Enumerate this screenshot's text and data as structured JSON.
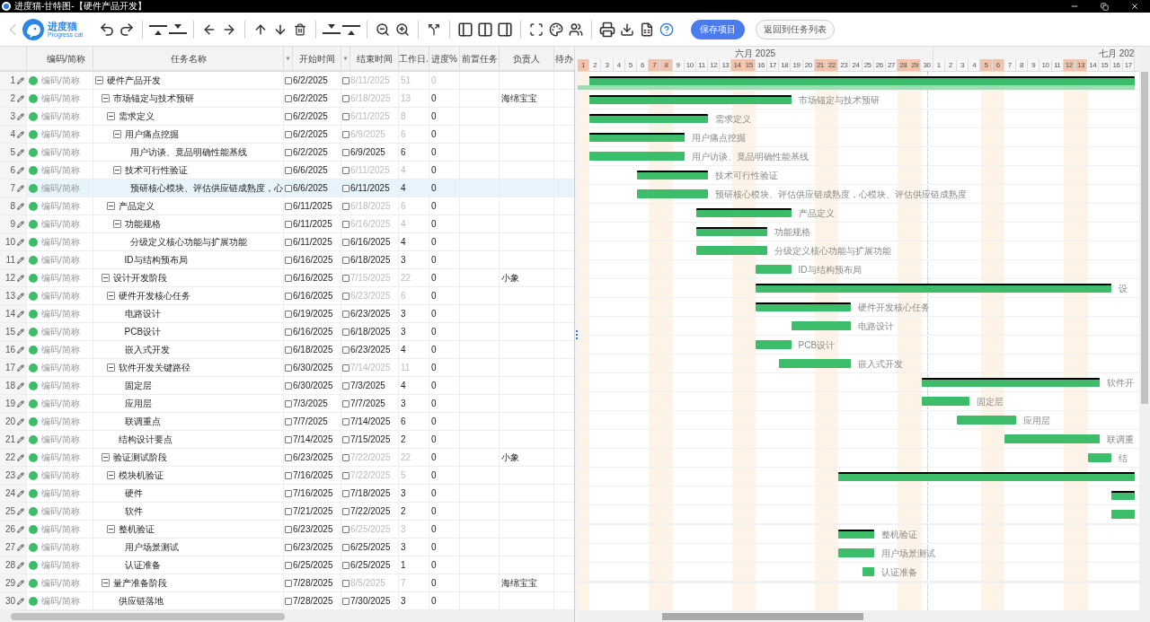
{
  "window": {
    "title": "进度猫-甘特图-【硬件产品开发】"
  },
  "logo": {
    "name": "进度猫",
    "tagline": "Progress cat"
  },
  "toolbar": {
    "save_button": "保存项目",
    "back_button": "返回到任务列表"
  },
  "table": {
    "columns": [
      "编码/简称",
      "任务名称",
      "✳",
      "开始时间",
      "✳",
      "结束时间",
      "工作日.",
      "进度%",
      "前置任务",
      "负责人",
      "待办"
    ],
    "rows": [
      {
        "n": "1",
        "code": "编码/简称",
        "name": "硬件产品开发",
        "start": "6/2/2025",
        "end": "8/11/2025",
        "days": "51",
        "progress": "0",
        "kind": "project",
        "expanded": true,
        "selected": false,
        "start_checked": false,
        "end_checked": false,
        "children": [
          {
            "n": "2",
            "code": "编码/简称",
            "name": "市场锚定与技术预研",
            "start": "6/2/2025",
            "end": "6/18/2025",
            "days": "13",
            "progress": "0",
            "owner": "海绵宝宝",
            "kind": "summary",
            "expanded": true,
            "selected": false,
            "start_checked": false,
            "end_checked": false,
            "bar_label": "市场锚定与技术预研",
            "children": [
              {
                "n": "3",
                "code": "编码/简称",
                "name": "需求定义",
                "start": "6/2/2025",
                "end": "6/11/2025",
                "days": "8",
                "progress": "0",
                "kind": "summary",
                "expanded": true,
                "selected": false,
                "start_checked": false,
                "end_checked": false,
                "bar_label": "需求定义",
                "children": [
                  {
                    "n": "4",
                    "code": "编码/简称",
                    "name": "用户痛点挖掘",
                    "start": "6/2/2025",
                    "end": "6/9/2025",
                    "days": "6",
                    "progress": "0",
                    "kind": "summary",
                    "expanded": true,
                    "selected": false,
                    "start_checked": false,
                    "end_checked": false,
                    "bar_label": "用户痛点挖掘",
                    "children": [
                      {
                        "n": "5",
                        "code": "编码/简称",
                        "name": "用户访谈、竟品明确性能基线",
                        "start": "6/2/2025",
                        "end": "6/9/2025",
                        "days": "6",
                        "progress": "0",
                        "kind": "task",
                        "selected": false,
                        "start_checked": false,
                        "end_checked": false,
                        "bar_label": "用户访谈、竟品明确性能基线"
                      }
                    ]
                  },
                  {
                    "n": "6",
                    "code": "编码/简称",
                    "name": "技术可行性验证",
                    "start": "6/6/2025",
                    "end": "6/11/2025",
                    "days": "4",
                    "progress": "0",
                    "kind": "summary",
                    "expanded": true,
                    "selected": false,
                    "start_checked": false,
                    "end_checked": false,
                    "bar_label": "技术可行性验证",
                    "children": [
                      {
                        "n": "7",
                        "code": "编码/简称",
                        "name": "预研核心模块、评估供应链成熟度，心",
                        "start": "6/6/2025",
                        "end": "6/11/2025",
                        "days": "4",
                        "progress": "0",
                        "kind": "task",
                        "selected": true,
                        "start_checked": false,
                        "end_checked": false,
                        "bar_label": "预研核心模块、评估供应链成熟度，心模块、评估供应链成熟度"
                      }
                    ]
                  }
                ]
              },
              {
                "n": "8",
                "code": "编码/简称",
                "name": "产品定义",
                "start": "6/11/2025",
                "end": "6/18/2025",
                "days": "6",
                "progress": "0",
                "kind": "summary",
                "expanded": true,
                "selected": false,
                "start_checked": false,
                "end_checked": false,
                "bar_label": "产品定义",
                "children": [
                  {
                    "n": "9",
                    "code": "编码/简称",
                    "name": "功能规格",
                    "start": "6/11/2025",
                    "end": "6/16/2025",
                    "days": "4",
                    "progress": "0",
                    "kind": "summary",
                    "expanded": true,
                    "selected": false,
                    "start_checked": false,
                    "end_checked": false,
                    "bar_label": "功能规格",
                    "children": [
                      {
                        "n": "10",
                        "code": "编码/简称",
                        "name": "分级定义核心功能与扩展功能",
                        "start": "6/11/2025",
                        "end": "6/16/2025",
                        "days": "4",
                        "progress": "0",
                        "kind": "task",
                        "selected": false,
                        "start_checked": false,
                        "end_checked": false,
                        "bar_label": "分级定义核心功能与扩展功能"
                      }
                    ]
                  },
                  {
                    "n": "11",
                    "code": "编码/简称",
                    "name": "ID与结构预布局",
                    "start": "6/16/2025",
                    "end": "6/18/2025",
                    "days": "3",
                    "progress": "0",
                    "kind": "task",
                    "selected": false,
                    "start_checked": false,
                    "end_checked": false,
                    "bar_label": "ID与结构预布局"
                  }
                ]
              }
            ]
          },
          {
            "n": "12",
            "code": "编码/简称",
            "name": "设计开发阶段",
            "start": "6/16/2025",
            "end": "7/15/2025",
            "days": "22",
            "progress": "0",
            "owner": "小象",
            "kind": "summary",
            "expanded": true,
            "selected": false,
            "start_checked": false,
            "end_checked": false,
            "bar_label": "设",
            "children": [
              {
                "n": "13",
                "code": "编码/简称",
                "name": "硬件开发核心任务",
                "start": "6/16/2025",
                "end": "6/23/2025",
                "days": "6",
                "progress": "0",
                "kind": "summary",
                "expanded": true,
                "selected": false,
                "start_checked": false,
                "end_checked": false,
                "bar_label": "硬件开发核心任务",
                "children": [
                  {
                    "n": "14",
                    "code": "编码/简称",
                    "name": "电路设计",
                    "start": "6/19/2025",
                    "end": "6/23/2025",
                    "days": "3",
                    "progress": "0",
                    "kind": "task",
                    "selected": false,
                    "start_checked": false,
                    "end_checked": false,
                    "bar_label": "电路设计"
                  },
                  {
                    "n": "15",
                    "code": "编码/简称",
                    "name": "PCB设计",
                    "start": "6/16/2025",
                    "end": "6/18/2025",
                    "days": "3",
                    "progress": "0",
                    "kind": "task",
                    "selected": false,
                    "start_checked": false,
                    "end_checked": false,
                    "bar_label": "PCB设计"
                  },
                  {
                    "n": "16",
                    "code": "编码/简称",
                    "name": "嵌入式开发",
                    "start": "6/18/2025",
                    "end": "6/23/2025",
                    "days": "4",
                    "progress": "0",
                    "kind": "task",
                    "selected": false,
                    "start_checked": false,
                    "end_checked": false,
                    "bar_label": "嵌入式开发"
                  }
                ]
              },
              {
                "n": "17",
                "code": "编码/简称",
                "name": "软件开发关键路径",
                "start": "6/30/2025",
                "end": "7/14/2025",
                "days": "11",
                "progress": "0",
                "kind": "summary",
                "expanded": true,
                "selected": false,
                "start_checked": false,
                "end_checked": false,
                "bar_label": "软件开",
                "children": [
                  {
                    "n": "18",
                    "code": "编码/简称",
                    "name": "固定层",
                    "start": "6/30/2025",
                    "end": "7/3/2025",
                    "days": "4",
                    "progress": "0",
                    "kind": "task",
                    "selected": false,
                    "start_checked": false,
                    "end_checked": false,
                    "bar_label": "固定层"
                  },
                  {
                    "n": "19",
                    "code": "编码/简称",
                    "name": "应用层",
                    "start": "7/3/2025",
                    "end": "7/7/2025",
                    "days": "3",
                    "progress": "0",
                    "kind": "task",
                    "selected": false,
                    "start_checked": false,
                    "end_checked": false,
                    "bar_label": "应用层"
                  },
                  {
                    "n": "20",
                    "code": "编码/简称",
                    "name": "联调重点",
                    "start": "7/7/2025",
                    "end": "7/14/2025",
                    "days": "6",
                    "progress": "0",
                    "kind": "task",
                    "selected": false,
                    "start_checked": false,
                    "end_checked": false,
                    "bar_label": "联调重"
                  }
                ]
              },
              {
                "n": "21",
                "code": "编码/简称",
                "name": "结构设计要点",
                "start": "7/14/2025",
                "end": "7/15/2025",
                "days": "2",
                "progress": "0",
                "kind": "task",
                "selected": false,
                "start_checked": false,
                "end_checked": false,
                "bar_label": "结"
              }
            ]
          },
          {
            "n": "22",
            "code": "编码/简称",
            "name": "验证测试阶段",
            "start": "6/23/2025",
            "end": "7/22/2025",
            "days": "22",
            "progress": "0",
            "owner": "小象",
            "kind": "summary",
            "expanded": true,
            "selected": false,
            "start_checked": false,
            "end_checked": false,
            "children": [
              {
                "n": "23",
                "code": "编码/简称",
                "name": "模块机验证",
                "start": "7/16/2025",
                "end": "7/22/2025",
                "days": "5",
                "progress": "0",
                "kind": "summary",
                "expanded": true,
                "selected": false,
                "start_checked": false,
                "end_checked": false,
                "children": [
                  {
                    "n": "24",
                    "code": "编码/简称",
                    "name": "硬件",
                    "start": "7/16/2025",
                    "end": "7/18/2025",
                    "days": "3",
                    "progress": "0",
                    "kind": "task",
                    "selected": false,
                    "start_checked": false,
                    "end_checked": false
                  },
                  {
                    "n": "25",
                    "code": "编码/简称",
                    "name": "软件",
                    "start": "7/21/2025",
                    "end": "7/22/2025",
                    "days": "2",
                    "progress": "0",
                    "kind": "task",
                    "selected": false,
                    "start_checked": false,
                    "end_checked": false
                  }
                ]
              },
              {
                "n": "26",
                "code": "编码/简称",
                "name": "整机验证",
                "start": "6/23/2025",
                "end": "6/25/2025",
                "days": "3",
                "progress": "0",
                "kind": "summary",
                "expanded": true,
                "selected": false,
                "start_checked": false,
                "end_checked": false,
                "bar_label": "整机验证",
                "children": [
                  {
                    "n": "27",
                    "code": "编码/简称",
                    "name": "用户场景测试",
                    "start": "6/23/2025",
                    "end": "6/25/2025",
                    "days": "3",
                    "progress": "0",
                    "kind": "task",
                    "selected": false,
                    "start_checked": false,
                    "end_checked": false,
                    "bar_label": "用户场景测试"
                  },
                  {
                    "n": "28",
                    "code": "编码/简称",
                    "name": "认证准备",
                    "start": "6/25/2025",
                    "end": "6/25/2025",
                    "days": "1",
                    "progress": "0",
                    "kind": "task",
                    "selected": false,
                    "start_checked": false,
                    "end_checked": false,
                    "bar_label": "认证准备"
                  }
                ]
              }
            ]
          },
          {
            "n": "29",
            "code": "编码/简称",
            "name": "量产准备阶段",
            "start": "7/28/2025",
            "end": "8/5/2025",
            "days": "7",
            "progress": "0",
            "owner": "海绵宝宝",
            "kind": "summary",
            "expanded": true,
            "selected": false,
            "start_checked": false,
            "end_checked": false,
            "children": [
              {
                "n": "30",
                "code": "编码/简称",
                "name": "供应链落地",
                "start": "7/28/2025",
                "end": "7/30/2025",
                "days": "3",
                "progress": "0",
                "kind": "task",
                "selected": false,
                "start_checked": false,
                "end_checked": false
              }
            ]
          }
        ]
      }
    ]
  },
  "gantt": {
    "months": [
      {
        "label": "六月 2025",
        "days": [
          {
            "label": "1",
            "weekend": true
          },
          {
            "label": "2",
            "weekend": false
          },
          {
            "label": "3",
            "weekend": false
          },
          {
            "label": "4",
            "weekend": false
          },
          {
            "label": "5",
            "weekend": false
          },
          {
            "label": "6",
            "weekend": false
          },
          {
            "label": "7",
            "weekend": true
          },
          {
            "label": "8",
            "weekend": true
          },
          {
            "label": "9",
            "weekend": false
          },
          {
            "label": "10",
            "weekend": false
          },
          {
            "label": "11",
            "weekend": false
          },
          {
            "label": "12",
            "weekend": false
          },
          {
            "label": "13",
            "weekend": false
          },
          {
            "label": "14",
            "weekend": true
          },
          {
            "label": "15",
            "weekend": true
          },
          {
            "label": "16",
            "weekend": false
          },
          {
            "label": "17",
            "weekend": false
          },
          {
            "label": "18",
            "weekend": false
          },
          {
            "label": "19",
            "weekend": false
          },
          {
            "label": "20",
            "weekend": false
          },
          {
            "label": "21",
            "weekend": true
          },
          {
            "label": "22",
            "weekend": true
          },
          {
            "label": "23",
            "weekend": false
          },
          {
            "label": "24",
            "weekend": false
          },
          {
            "label": "25",
            "weekend": false
          },
          {
            "label": "26",
            "weekend": false
          },
          {
            "label": "27",
            "weekend": false
          },
          {
            "label": "28",
            "weekend": true
          },
          {
            "label": "29",
            "weekend": true
          },
          {
            "label": "30",
            "weekend": false
          }
        ]
      },
      {
        "label": "七月 202",
        "days": [
          {
            "label": "1",
            "weekend": false
          },
          {
            "label": "2",
            "weekend": false
          },
          {
            "label": "3",
            "weekend": false
          },
          {
            "label": "4",
            "weekend": false
          },
          {
            "label": "5",
            "weekend": true
          },
          {
            "label": "6",
            "weekend": true
          },
          {
            "label": "7",
            "weekend": false
          },
          {
            "label": "8",
            "weekend": false
          },
          {
            "label": "9",
            "weekend": false
          },
          {
            "label": "10",
            "weekend": false
          },
          {
            "label": "11",
            "weekend": false
          },
          {
            "label": "12",
            "weekend": true
          },
          {
            "label": "13",
            "weekend": true
          },
          {
            "label": "14",
            "weekend": false
          },
          {
            "label": "15",
            "weekend": false
          },
          {
            "label": "16",
            "weekend": false
          },
          {
            "label": "17",
            "weekend": false
          }
        ]
      }
    ]
  }
}
